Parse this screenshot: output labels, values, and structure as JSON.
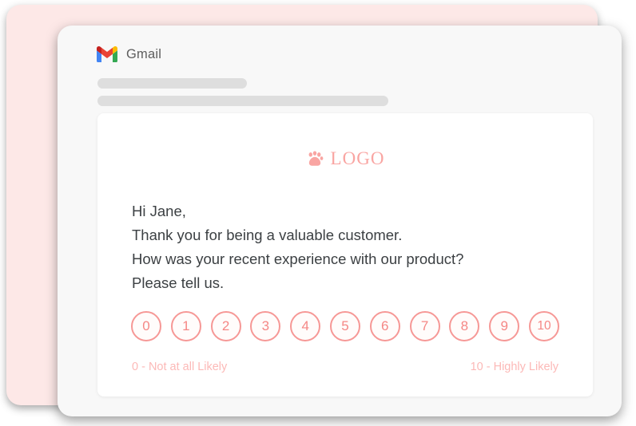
{
  "window": {
    "mail_client": "Gmail",
    "mail_client_icon": "gmail-m-icon"
  },
  "skeleton": {
    "bar_one": "",
    "bar_two": ""
  },
  "email": {
    "logo": {
      "icon": "paw-print-icon",
      "text": "LOGO",
      "color": "#F9A5A2"
    },
    "body_lines": [
      "Hi Jane,",
      "Thank you for being a valuable customer.",
      "How was your recent experience with our product?",
      "Please tell us."
    ],
    "nps": {
      "options": [
        "0",
        "1",
        "2",
        "3",
        "4",
        "5",
        "6",
        "7",
        "8",
        "9",
        "10"
      ],
      "low_label": "0 - Not at all Likely",
      "high_label": "10 - Highly Likely",
      "accent_color": "#F69896",
      "label_color": "#FCB9B7"
    }
  },
  "theme": {
    "back_card_color": "#FDE8E7",
    "window_color": "#F8F8F8",
    "card_color": "#FFFFFF",
    "text_color": "#3C4043"
  }
}
